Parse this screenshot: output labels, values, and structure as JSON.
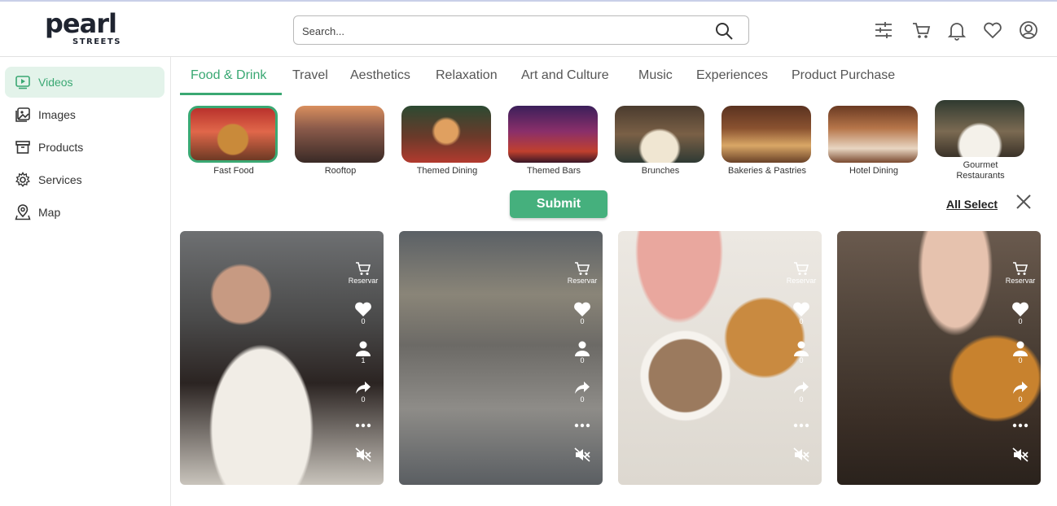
{
  "brand": {
    "name": "pearl",
    "tagline": "STREETS"
  },
  "search": {
    "placeholder": "Search..."
  },
  "header_icons": [
    "filter-icon",
    "cart-icon",
    "bell-icon",
    "heart-icon",
    "user-circle-icon"
  ],
  "sidebar": {
    "items": [
      {
        "label": "Videos",
        "icon": "video-icon",
        "active": true
      },
      {
        "label": "Images",
        "icon": "image-icon",
        "active": false
      },
      {
        "label": "Products",
        "icon": "box-icon",
        "active": false
      },
      {
        "label": "Services",
        "icon": "gear-icon",
        "active": false
      },
      {
        "label": "Map",
        "icon": "map-pin-icon",
        "active": false
      }
    ]
  },
  "tabs": [
    {
      "label": "Food & Drink",
      "active": true
    },
    {
      "label": "Travel"
    },
    {
      "label": "Aesthetics"
    },
    {
      "label": "Relaxation"
    },
    {
      "label": "Art and Culture"
    },
    {
      "label": "Music"
    },
    {
      "label": "Experiences"
    },
    {
      "label": "Product Purchase"
    }
  ],
  "categories": [
    {
      "label": "Fast Food",
      "selected": true
    },
    {
      "label": "Rooftop"
    },
    {
      "label": "Themed Dining"
    },
    {
      "label": "Themed Bars"
    },
    {
      "label": "Brunches"
    },
    {
      "label": "Bakeries & Pastries"
    },
    {
      "label": "Hotel Dining"
    },
    {
      "label": "Gourmet Restaurants"
    }
  ],
  "actions": {
    "submit": "Submit",
    "all_select": "All Select"
  },
  "accent_color": "#3aa873",
  "videos": [
    {
      "reserve_label": "Reservar",
      "likes": "0",
      "follows": "1",
      "shares": "0"
    },
    {
      "reserve_label": "Reservar",
      "likes": "0",
      "follows": "0",
      "shares": "0"
    },
    {
      "reserve_label": "Reservar",
      "likes": "0",
      "follows": "0",
      "shares": "0"
    },
    {
      "reserve_label": "Reservar",
      "likes": "0",
      "follows": "0",
      "shares": "0"
    }
  ]
}
